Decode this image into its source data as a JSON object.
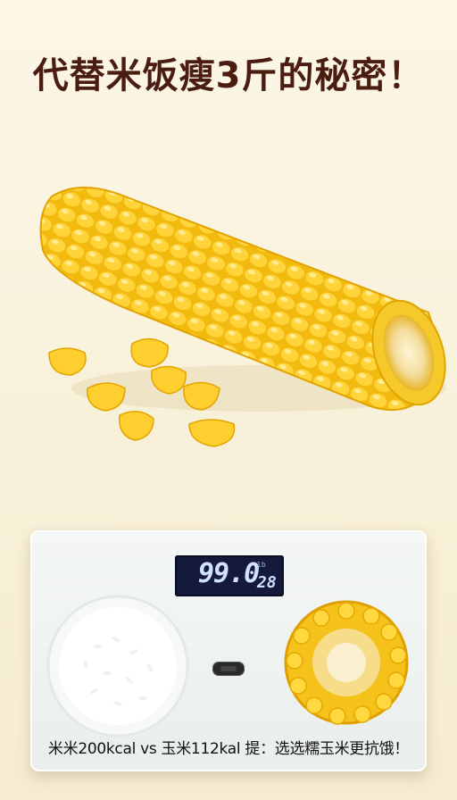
{
  "headline": "代替米饭瘦3斤的秘密！",
  "scale": {
    "weight_reading": "99.0",
    "unit_label": "lb",
    "sub_reading": "28"
  },
  "caption": "米米200kcal vs 玉米112kal  提：选选糯玉米更抗饿！",
  "icons": [
    "corn-cob-icon",
    "corn-kernel-icon",
    "rice-bowl-icon",
    "corn-slice-icon",
    "scale-icon"
  ]
}
